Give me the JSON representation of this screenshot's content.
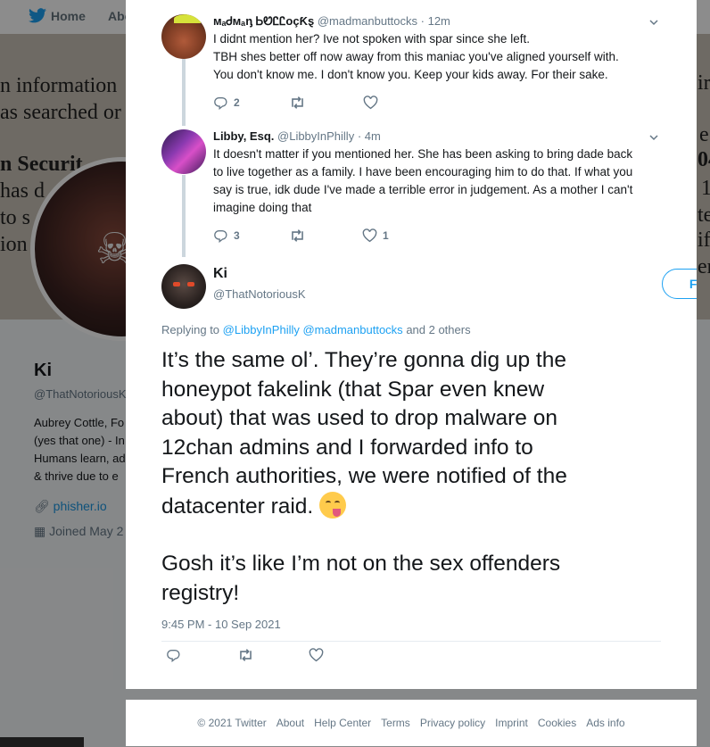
{
  "background": {
    "nav": {
      "home": "Home",
      "about": "Abo"
    },
    "banner_text": [
      "n information",
      "as searched or",
      "n Securit",
      "has d",
      "to s",
      "ion",
      "ir",
      "e",
      "04",
      "1",
      "te",
      "if",
      "err"
    ],
    "profile": {
      "name": "Ki",
      "handle": "@ThatNotoriousK",
      "bio_lines": [
        "Aubrey Cottle, Fo",
        "(yes that one) - In",
        "Humans learn, ad",
        "& thrive due to e"
      ],
      "website": "phisher.io",
      "joined": "Joined May 2"
    }
  },
  "thread": {
    "tweets": [
      {
        "name": "ᴍₐᏧᴍₐᶇ ᏏᏬᏝᏝᴏçƘȿ",
        "handle": "@madmanbuttocks",
        "time": "· 12m",
        "lines": [
          "I didnt mention her? Ive not spoken with spar since she left.",
          "TBH shes better off now away from this maniac you've aligned yourself with.",
          "You don't know me. I don't know you. Keep your kids away. For their sake."
        ],
        "replies": "2",
        "retweets": "",
        "likes": ""
      },
      {
        "name": "Libby, Esq.",
        "handle": "@LibbyInPhilly",
        "time": "· 4m",
        "lines": [
          "It doesn't matter if you mentioned her. She has been asking to bring dade back",
          "to live together as a family. I have been encouraging him to do that. If what you",
          "say is true, idk dude I've made a terrible error in judgement. As a mother I can't",
          "imagine doing that"
        ],
        "replies": "3",
        "retweets": "",
        "likes": "1"
      }
    ],
    "main": {
      "name": "Ki",
      "handle": "@ThatNotoriousK",
      "follow_label": "Follow",
      "replying_prefix": "Replying to",
      "mention_1": "@LibbyInPhilly",
      "mention_2": "@madmanbuttocks",
      "replying_suffix": "and 2 others",
      "lines": [
        "It’s the same ol’. They’re gonna dig up the",
        "honeypot fakelink (that Spar even knew",
        "about) that was used to drop malware on",
        "12chan admins and I forwarded info to",
        "French authorities, we were notified of the",
        "datacenter raid."
      ],
      "lines_2": [
        "Gosh it’s like I’m not on the sex offenders",
        "registry!"
      ],
      "timestamp": "9:45 PM - 10 Sep 2021"
    }
  },
  "footer": [
    "© 2021 Twitter",
    "About",
    "Help Center",
    "Terms",
    "Privacy policy",
    "Imprint",
    "Cookies",
    "Ads info"
  ],
  "colors": {
    "accent": "#1da1f2",
    "muted": "#657786",
    "text": "#14171a"
  }
}
